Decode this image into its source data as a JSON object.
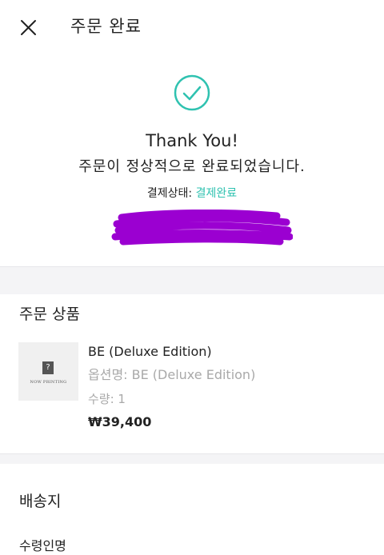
{
  "header": {
    "title": "주문 완료"
  },
  "confirmation": {
    "thanks": "Thank You!",
    "message": "주문이 정상적으로 완료되었습니다.",
    "payment_status_label": "결제상태: ",
    "payment_status_value": "결제완료"
  },
  "products": {
    "section_title": "주문 상품",
    "items": [
      {
        "name": "BE (Deluxe Edition)",
        "option": "옵션명: BE (Deluxe Edition)",
        "quantity": "수량: 1",
        "price": "₩39,400",
        "thumbnail_text": "NOW PRINTING",
        "thumbnail_mark": "?"
      }
    ]
  },
  "shipping": {
    "section_title": "배송지",
    "recipient_label": "수령인명"
  },
  "colors": {
    "accent": "#2fc2b0",
    "redaction": "#9b00d1",
    "muted_text": "#a9a9a9",
    "divider": "#f4f4f6"
  }
}
